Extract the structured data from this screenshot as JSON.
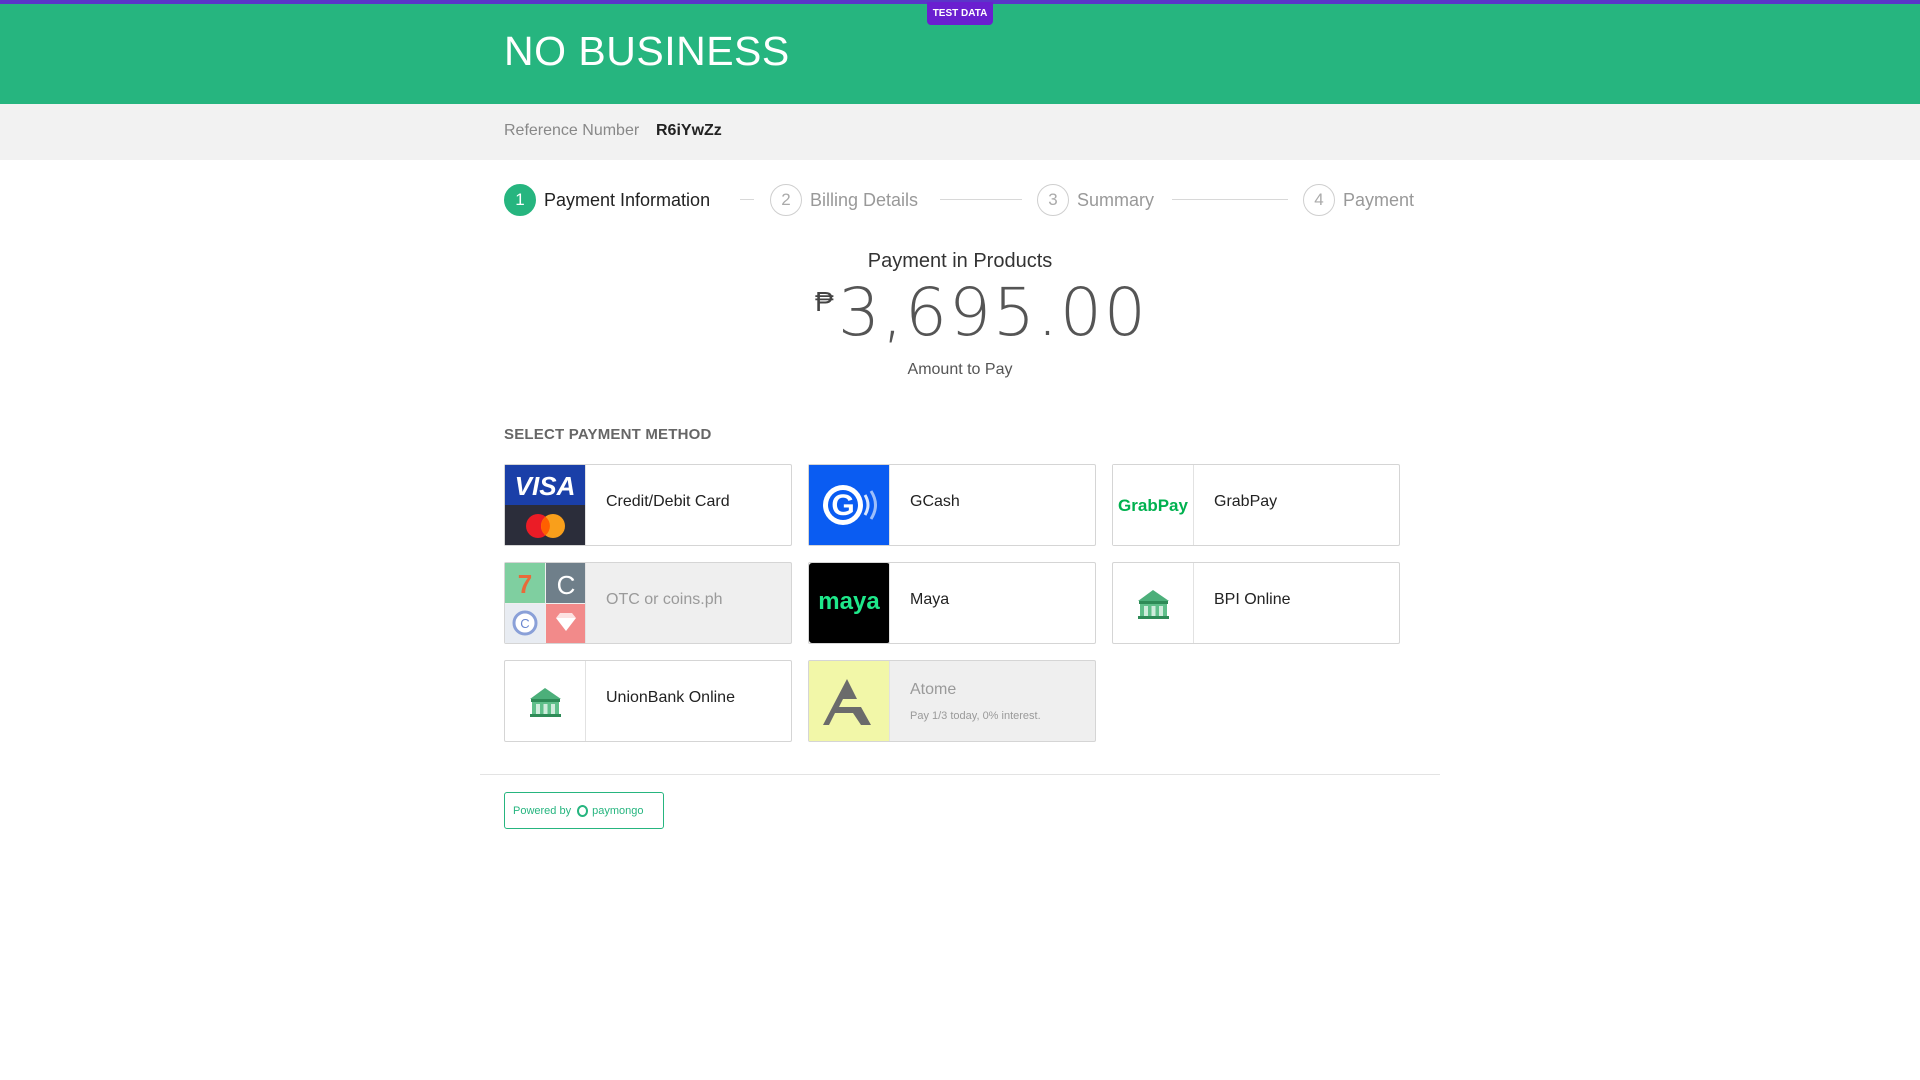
{
  "header": {
    "business_name": "NO BUSINESS",
    "test_badge": "TEST DATA",
    "brand_color": "#26b57f",
    "accent_color": "#6a1fd0"
  },
  "reference": {
    "label": "Reference Number",
    "value": "R6iYwZz"
  },
  "stepper": {
    "steps": [
      {
        "number": "1",
        "label": "Payment Information",
        "active": true
      },
      {
        "number": "2",
        "label": "Billing Details",
        "active": false
      },
      {
        "number": "3",
        "label": "Summary",
        "active": false
      },
      {
        "number": "4",
        "label": "Payment",
        "active": false
      }
    ]
  },
  "payment": {
    "title": "Payment in Products",
    "currency_symbol": "₱",
    "amount": "3,695.00",
    "amount_label": "Amount to Pay"
  },
  "methods": {
    "section_label": "SELECT PAYMENT METHOD",
    "items": [
      {
        "label": "Credit/Debit Card",
        "icon": "visa-mastercard-icon",
        "disabled": false
      },
      {
        "label": "GCash",
        "icon": "gcash-icon",
        "disabled": false
      },
      {
        "label": "GrabPay",
        "icon": "grabpay-icon",
        "logo_text": "GrabPay",
        "disabled": false
      },
      {
        "label": "OTC or coins.ph",
        "icon": "otc-coins-icon",
        "disabled": true
      },
      {
        "label": "Maya",
        "icon": "maya-icon",
        "logo_text": "maya",
        "disabled": false
      },
      {
        "label": "BPI Online",
        "icon": "bank-icon",
        "disabled": false
      },
      {
        "label": "UnionBank Online",
        "icon": "bank-icon",
        "disabled": false
      },
      {
        "label": "Atome",
        "sub": "Pay 1/3 today, 0% interest.",
        "icon": "atome-icon",
        "disabled": true
      }
    ]
  },
  "footer": {
    "powered_by": "Powered by",
    "provider": "paymongo"
  }
}
